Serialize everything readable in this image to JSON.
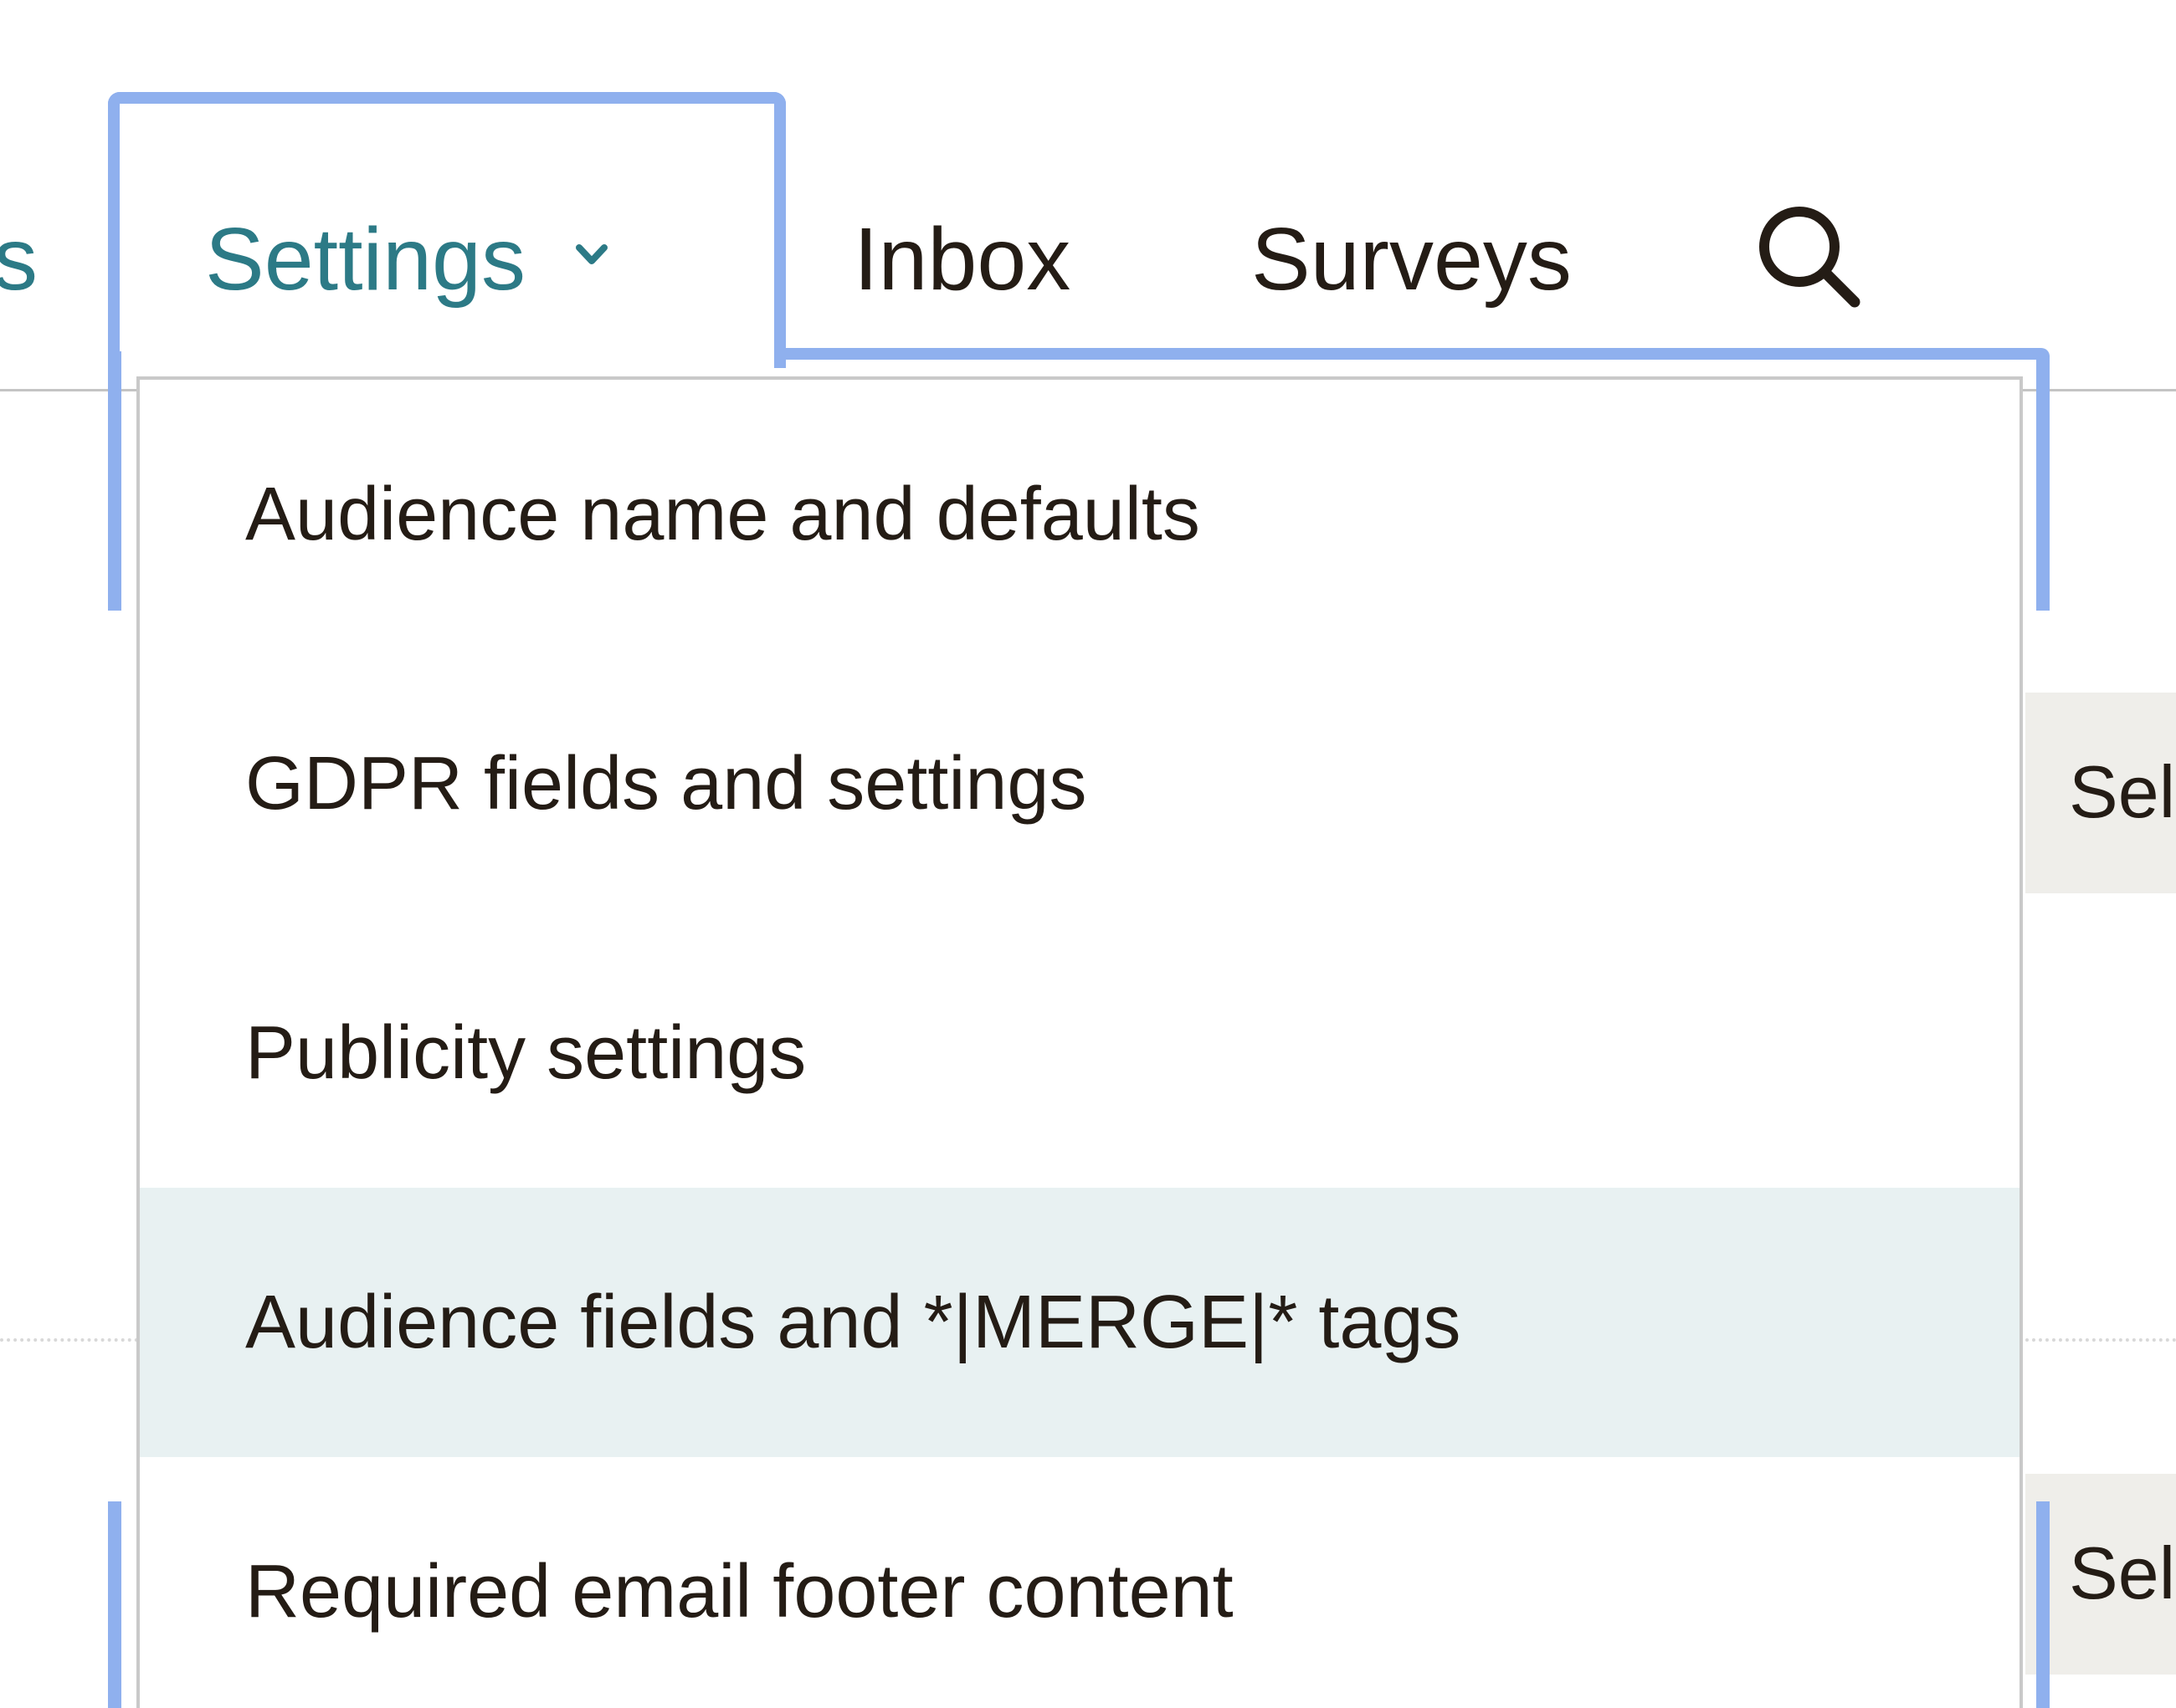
{
  "nav": {
    "partial_label": "s",
    "settings_label": "Settings",
    "inbox_label": "Inbox",
    "surveys_label": "Surveys"
  },
  "background": {
    "chip_1_label": "Sel",
    "chip_2_label": "Sel"
  },
  "dropdown": {
    "items": [
      {
        "label": "Audience name and defaults"
      },
      {
        "label": "GDPR fields and settings"
      },
      {
        "label": "Publicity settings"
      },
      {
        "label": "Audience fields and *|MERGE|* tags"
      },
      {
        "label": "Required email footer content"
      }
    ],
    "highlighted_index": 3
  },
  "colors": {
    "accent": "#2c7a86",
    "focus_ring": "#8fb0ee",
    "highlight": "#e8f1f2",
    "text": "#241c15"
  },
  "icons": {
    "settings_chevron": "chevron-down-icon",
    "search": "search-icon"
  }
}
